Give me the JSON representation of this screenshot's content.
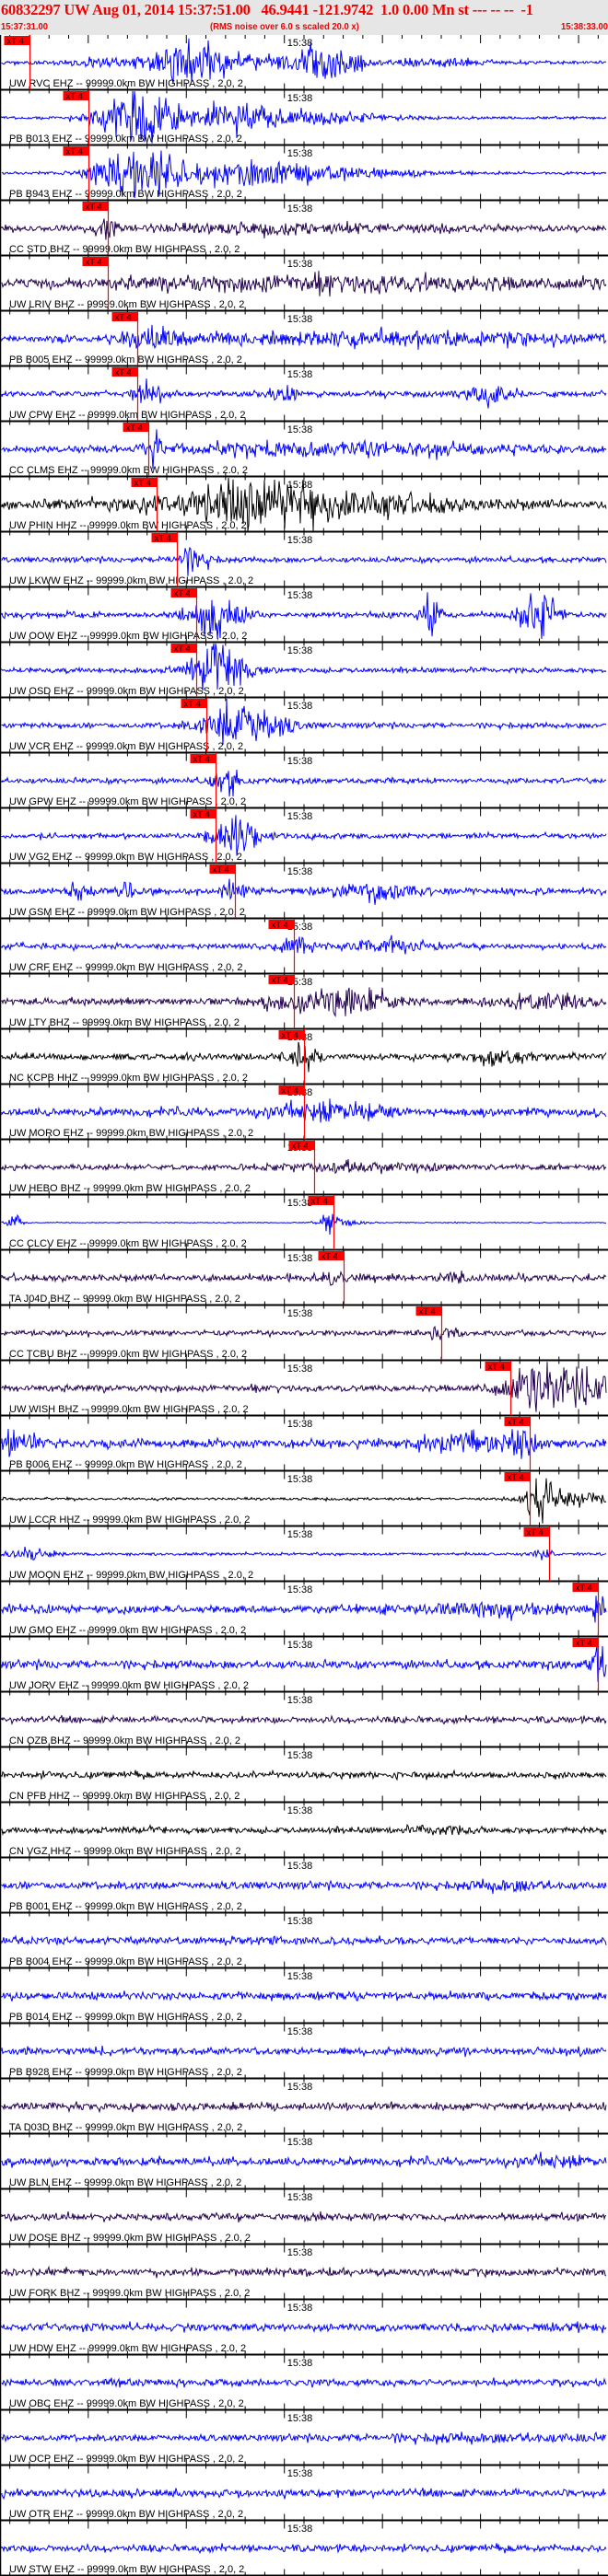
{
  "header": {
    "title": "60832297 UW Aug 01, 2014 15:37:51.00   46.9441 -121.9742  1.0 0.00 Mn st --- -- --  -1",
    "start_time": "15:37:31.00",
    "note": "(RMS noise over 6.0 s scaled 20.0 x)",
    "end_time": "15:38:33.00"
  },
  "colors": {
    "title": "#f00000",
    "pick": "#ff0000",
    "EHZ": "#0000ff",
    "BHZ": "#22004f",
    "HHZ": "#000000",
    "header_bg": "#e6e6e6"
  },
  "chart_data": {
    "type": "line",
    "title": "60832297 UW Aug 01, 2014 15:37:51.00",
    "x_range_s": [
      0,
      62
    ],
    "x_start_label": "15:37:31.00",
    "x_end_label": "15:38:33.00",
    "minute_tick": {
      "time_s": 29,
      "label": "15:38"
    },
    "major_tick_times_s": [
      9,
      19,
      29,
      39,
      49,
      59
    ],
    "pick_label": "xT 4",
    "filter_suffix": "-- 99999.0km BW  HIGHPASS , 2.0, 2",
    "traces": [
      {
        "station": "UW RVC EHZ",
        "comp": "EHZ",
        "pick_s": 3.0,
        "noise": 0.06,
        "bursts": [
          [
            20,
            0.35,
            10
          ],
          [
            19,
            0.8,
            2.5
          ],
          [
            33,
            0.8,
            3
          ],
          [
            44,
            0.15,
            5
          ]
        ]
      },
      {
        "station": "PB B013 EHZ",
        "comp": "EHZ",
        "pick_s": 9.0,
        "noise": 0.05,
        "bursts": [
          [
            14,
            1.0,
            4
          ],
          [
            24,
            0.45,
            8
          ],
          [
            35,
            0.15,
            8
          ]
        ]
      },
      {
        "station": "PB B943 EHZ",
        "comp": "EHZ",
        "pick_s": 9.0,
        "noise": 0.05,
        "bursts": [
          [
            14,
            1.0,
            4
          ],
          [
            24,
            0.5,
            8
          ],
          [
            35,
            0.2,
            8
          ]
        ]
      },
      {
        "station": "CC STD BHZ",
        "comp": "BHZ",
        "pick_s": 11.0,
        "noise": 0.1,
        "bursts": [
          [
            11,
            0.5,
            0.8
          ],
          [
            30,
            0.15,
            20
          ]
        ]
      },
      {
        "station": "UW LRIV BHZ",
        "comp": "BHZ",
        "pick_s": 11.0,
        "noise": 0.12,
        "bursts": [
          [
            35,
            0.3,
            25
          ]
        ]
      },
      {
        "station": "PB B005 EHZ",
        "comp": "EHZ",
        "pick_s": 14.0,
        "noise": 0.12,
        "bursts": [
          [
            16,
            0.35,
            3
          ],
          [
            40,
            0.25,
            20
          ]
        ]
      },
      {
        "station": "UW CPW EHZ",
        "comp": "EHZ",
        "pick_s": 14.0,
        "noise": 0.1,
        "bursts": [
          [
            15,
            0.4,
            1.5
          ],
          [
            29,
            0.3,
            1.5
          ],
          [
            50,
            0.4,
            2.5
          ]
        ]
      },
      {
        "station": "CC CLMS EHZ",
        "comp": "EHZ",
        "pick_s": 15.1,
        "noise": 0.1,
        "bursts": [
          [
            15.5,
            0.45,
            1
          ],
          [
            35,
            0.25,
            20
          ]
        ]
      },
      {
        "station": "UW PHIN HHZ",
        "comp": "HHZ",
        "pick_s": 16.0,
        "noise": 0.15,
        "bursts": [
          [
            30,
            0.7,
            14
          ],
          [
            25,
            0.5,
            4
          ]
        ]
      },
      {
        "station": "UW LKWW EHZ",
        "comp": "EHZ",
        "pick_s": 18.0,
        "noise": 0.1,
        "bursts": [
          [
            19.5,
            0.4,
            2
          ]
        ]
      },
      {
        "station": "UW OOW EHZ",
        "comp": "EHZ",
        "pick_s": 20.0,
        "noise": 0.1,
        "bursts": [
          [
            22,
            1.0,
            2.5
          ],
          [
            44,
            0.9,
            0.8
          ],
          [
            55,
            1.0,
            2
          ]
        ]
      },
      {
        "station": "UW OSD EHZ",
        "comp": "EHZ",
        "pick_s": 20.0,
        "noise": 0.1,
        "bursts": [
          [
            22.5,
            1.0,
            3
          ]
        ]
      },
      {
        "station": "UW VCR EHZ",
        "comp": "EHZ",
        "pick_s": 21.0,
        "noise": 0.1,
        "bursts": [
          [
            25,
            0.85,
            4
          ]
        ]
      },
      {
        "station": "UW GPW EHZ",
        "comp": "EHZ",
        "pick_s": 22.0,
        "noise": 0.1,
        "bursts": [
          [
            23,
            0.5,
            1.5
          ]
        ]
      },
      {
        "station": "UW VG2 EHZ",
        "comp": "EHZ",
        "pick_s": 22.0,
        "noise": 0.1,
        "bursts": [
          [
            24,
            1.0,
            2
          ]
        ]
      },
      {
        "station": "UW GSM EHZ",
        "comp": "EHZ",
        "pick_s": 24.0,
        "noise": 0.12,
        "bursts": [
          [
            8,
            0.3,
            1
          ],
          [
            13,
            0.3,
            1
          ],
          [
            24,
            0.3,
            1.5
          ],
          [
            38,
            0.3,
            4
          ]
        ]
      },
      {
        "station": "UW CRF EHZ",
        "comp": "EHZ",
        "pick_s": 30.0,
        "noise": 0.1,
        "bursts": [
          [
            30,
            0.35,
            1.5
          ],
          [
            40,
            0.25,
            4
          ]
        ]
      },
      {
        "station": "UW LTY BHZ",
        "comp": "BHZ",
        "pick_s": 30.0,
        "noise": 0.12,
        "bursts": [
          [
            34,
            0.55,
            6
          ],
          [
            55,
            0.25,
            6
          ]
        ]
      },
      {
        "station": "NC KCPB HHZ",
        "comp": "HHZ",
        "pick_s": 31.0,
        "noise": 0.12,
        "bursts": [
          [
            31,
            0.55,
            1.5
          ],
          [
            51,
            0.3,
            3
          ]
        ]
      },
      {
        "station": "UW MORO EHZ",
        "comp": "EHZ",
        "pick_s": 31.0,
        "noise": 0.15,
        "bursts": [
          [
            34,
            0.35,
            5
          ]
        ]
      },
      {
        "station": "UW HEBO BHZ",
        "comp": "BHZ",
        "pick_s": 32.0,
        "noise": 0.1,
        "bursts": [
          [
            36,
            0.15,
            8
          ]
        ]
      },
      {
        "station": "CC CLCV EHZ",
        "comp": "EHZ",
        "pick_s": 34.0,
        "noise": 0.02,
        "bursts": [
          [
            33.5,
            0.4,
            0.6
          ],
          [
            1.5,
            0.35,
            0.7
          ],
          [
            35,
            0.2,
            2
          ]
        ]
      },
      {
        "station": "TA J04D BHZ",
        "comp": "BHZ",
        "pick_s": 35.0,
        "noise": 0.12,
        "bursts": [
          [
            34,
            0.3,
            1.5
          ],
          [
            47,
            0.2,
            2
          ]
        ]
      },
      {
        "station": "CC TCBU BHZ",
        "comp": "BHZ",
        "pick_s": 45.0,
        "noise": 0.1,
        "bursts": [
          [
            45,
            0.3,
            1.5
          ]
        ]
      },
      {
        "station": "UW WISH BHZ",
        "comp": "BHZ",
        "pick_s": 52.0,
        "noise": 0.12,
        "bursts": [
          [
            57,
            1.0,
            5
          ]
        ]
      },
      {
        "station": "PB B006 EHZ",
        "comp": "EHZ",
        "pick_s": 54.0,
        "noise": 0.15,
        "bursts": [
          [
            2,
            0.35,
            2
          ],
          [
            53,
            0.45,
            1.5
          ],
          [
            48,
            0.3,
            6
          ]
        ]
      },
      {
        "station": "UW LCCR HHZ",
        "comp": "HHZ",
        "pick_s": 54.0,
        "noise": 0.05,
        "bursts": [
          [
            55,
            1.0,
            1.5
          ],
          [
            59,
            0.35,
            3
          ]
        ]
      },
      {
        "station": "UW MOON EHZ",
        "comp": "EHZ",
        "pick_s": 56.0,
        "noise": 0.05,
        "bursts": [
          [
            3,
            0.2,
            3
          ],
          [
            55.5,
            0.2,
            1
          ]
        ]
      },
      {
        "station": "UW GMO EHZ",
        "comp": "EHZ",
        "pick_s": 61.0,
        "noise": 0.15,
        "bursts": [
          [
            61,
            0.6,
            0.8
          ],
          [
            50,
            0.2,
            8
          ]
        ]
      },
      {
        "station": "UW JORV EHZ",
        "comp": "EHZ",
        "pick_s": 61.0,
        "noise": 0.15,
        "bursts": [
          [
            61,
            0.8,
            1
          ]
        ]
      },
      {
        "station": "CN OZB BHZ",
        "comp": "BHZ",
        "pick_s": null,
        "noise": 0.12,
        "bursts": []
      },
      {
        "station": "CN PFB HHZ",
        "comp": "HHZ",
        "pick_s": null,
        "noise": 0.12,
        "bursts": []
      },
      {
        "station": "CN VGZ HHZ",
        "comp": "HHZ",
        "pick_s": null,
        "noise": 0.12,
        "bursts": [
          [
            45,
            0.15,
            3
          ]
        ]
      },
      {
        "station": "PB B001 EHZ",
        "comp": "EHZ",
        "pick_s": null,
        "noise": 0.14,
        "bursts": [
          [
            52,
            0.15,
            4
          ]
        ]
      },
      {
        "station": "PB B004 EHZ",
        "comp": "EHZ",
        "pick_s": null,
        "noise": 0.14,
        "bursts": []
      },
      {
        "station": "PB B014 EHZ",
        "comp": "EHZ",
        "pick_s": null,
        "noise": 0.14,
        "bursts": []
      },
      {
        "station": "PB B928 EHZ",
        "comp": "EHZ",
        "pick_s": null,
        "noise": 0.14,
        "bursts": []
      },
      {
        "station": "TA D03D BHZ",
        "comp": "BHZ",
        "pick_s": null,
        "noise": 0.14,
        "bursts": []
      },
      {
        "station": "UW BLN EHZ",
        "comp": "EHZ",
        "pick_s": null,
        "noise": 0.15,
        "bursts": [
          [
            57,
            0.15,
            3
          ]
        ]
      },
      {
        "station": "UW DOSE BHZ",
        "comp": "BHZ",
        "pick_s": null,
        "noise": 0.13,
        "bursts": []
      },
      {
        "station": "UW FORK BHZ",
        "comp": "BHZ",
        "pick_s": null,
        "noise": 0.14,
        "bursts": []
      },
      {
        "station": "UW HDW EHZ",
        "comp": "EHZ",
        "pick_s": null,
        "noise": 0.15,
        "bursts": []
      },
      {
        "station": "UW OBC EHZ",
        "comp": "EHZ",
        "pick_s": null,
        "noise": 0.13,
        "bursts": []
      },
      {
        "station": "UW OCP EHZ",
        "comp": "EHZ",
        "pick_s": null,
        "noise": 0.12,
        "bursts": [
          [
            50,
            0.1,
            12
          ]
        ]
      },
      {
        "station": "UW OTR EHZ",
        "comp": "EHZ",
        "pick_s": null,
        "noise": 0.14,
        "bursts": []
      },
      {
        "station": "UW STW EHZ",
        "comp": "EHZ",
        "pick_s": null,
        "noise": 0.13,
        "bursts": []
      }
    ]
  }
}
